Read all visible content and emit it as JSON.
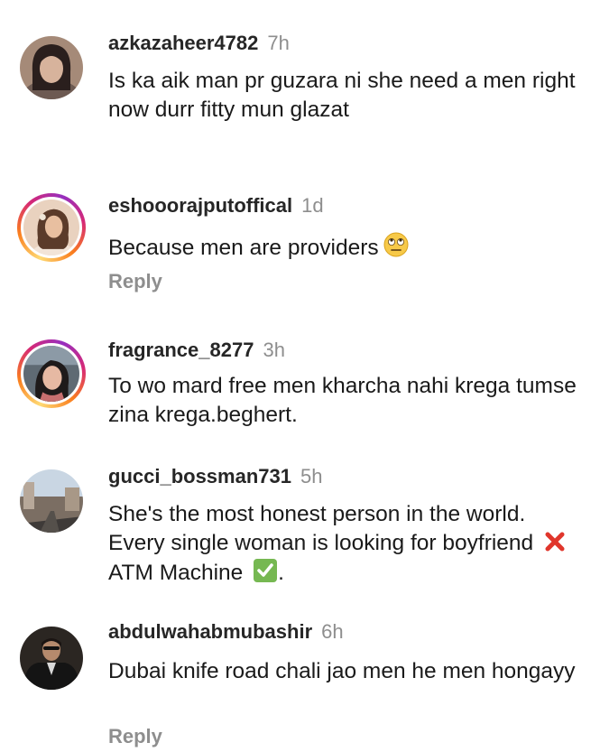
{
  "comments": [
    {
      "username": "azkazaheer4782",
      "time": "7h",
      "text": "Is ka aik man pr guzara ni she need a men right now  durr fitty mun glazat"
    },
    {
      "username": "eshooorajputoffical",
      "time": "1d",
      "text": "Because men are providers",
      "emoji": "eye-roll-emoji",
      "reply": "Reply"
    },
    {
      "username": "fragrance_8277",
      "time": "3h",
      "text": "To wo mard free men kharcha nahi krega tumse zina krega.beghert."
    },
    {
      "username": "gucci_bossman731",
      "time": "5h",
      "text_before": "She's the most honest person in the world. Every single woman is looking for boyfriend",
      "text_middle": "ATM Machine",
      "text_after": ".",
      "emojis": [
        "red-cross-mark-emoji",
        "green-check-mark-emoji"
      ]
    },
    {
      "username": "abdulwahabmubashir",
      "time": "6h",
      "text": "Dubai knife road chali jao men he men hongayy",
      "reply": "Reply"
    }
  ],
  "colors": {
    "text": "#262626",
    "muted": "#8e8e8e",
    "story_ring_start": "#feda75",
    "story_ring_end": "#962fbf"
  }
}
